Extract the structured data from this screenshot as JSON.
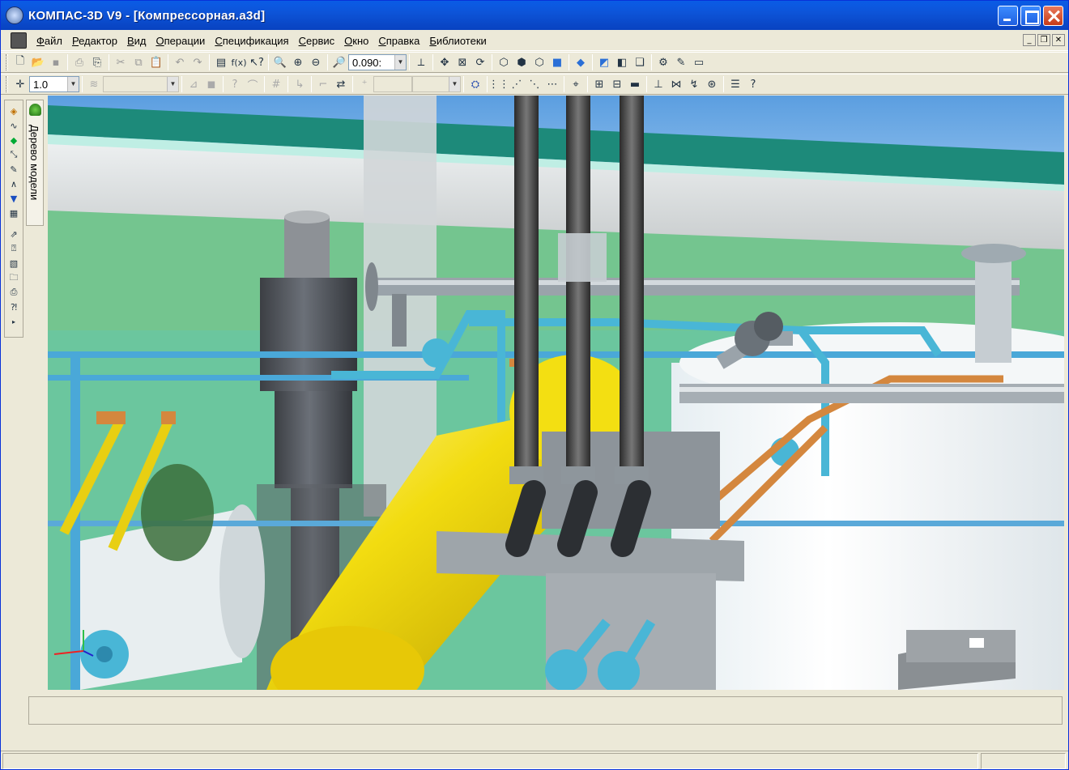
{
  "window": {
    "title": "КОМПАС-3D V9 - [Компрессорная.a3d]"
  },
  "menu": {
    "items": [
      "Файл",
      "Редактор",
      "Вид",
      "Операции",
      "Спецификация",
      "Сервис",
      "Окно",
      "Справка",
      "Библиотеки"
    ]
  },
  "toolbar_main": {
    "zoom_value": "0.090:"
  },
  "toolbar_params": {
    "step_value": "1.0"
  },
  "tree_panel": {
    "label": "Дерево модели"
  }
}
